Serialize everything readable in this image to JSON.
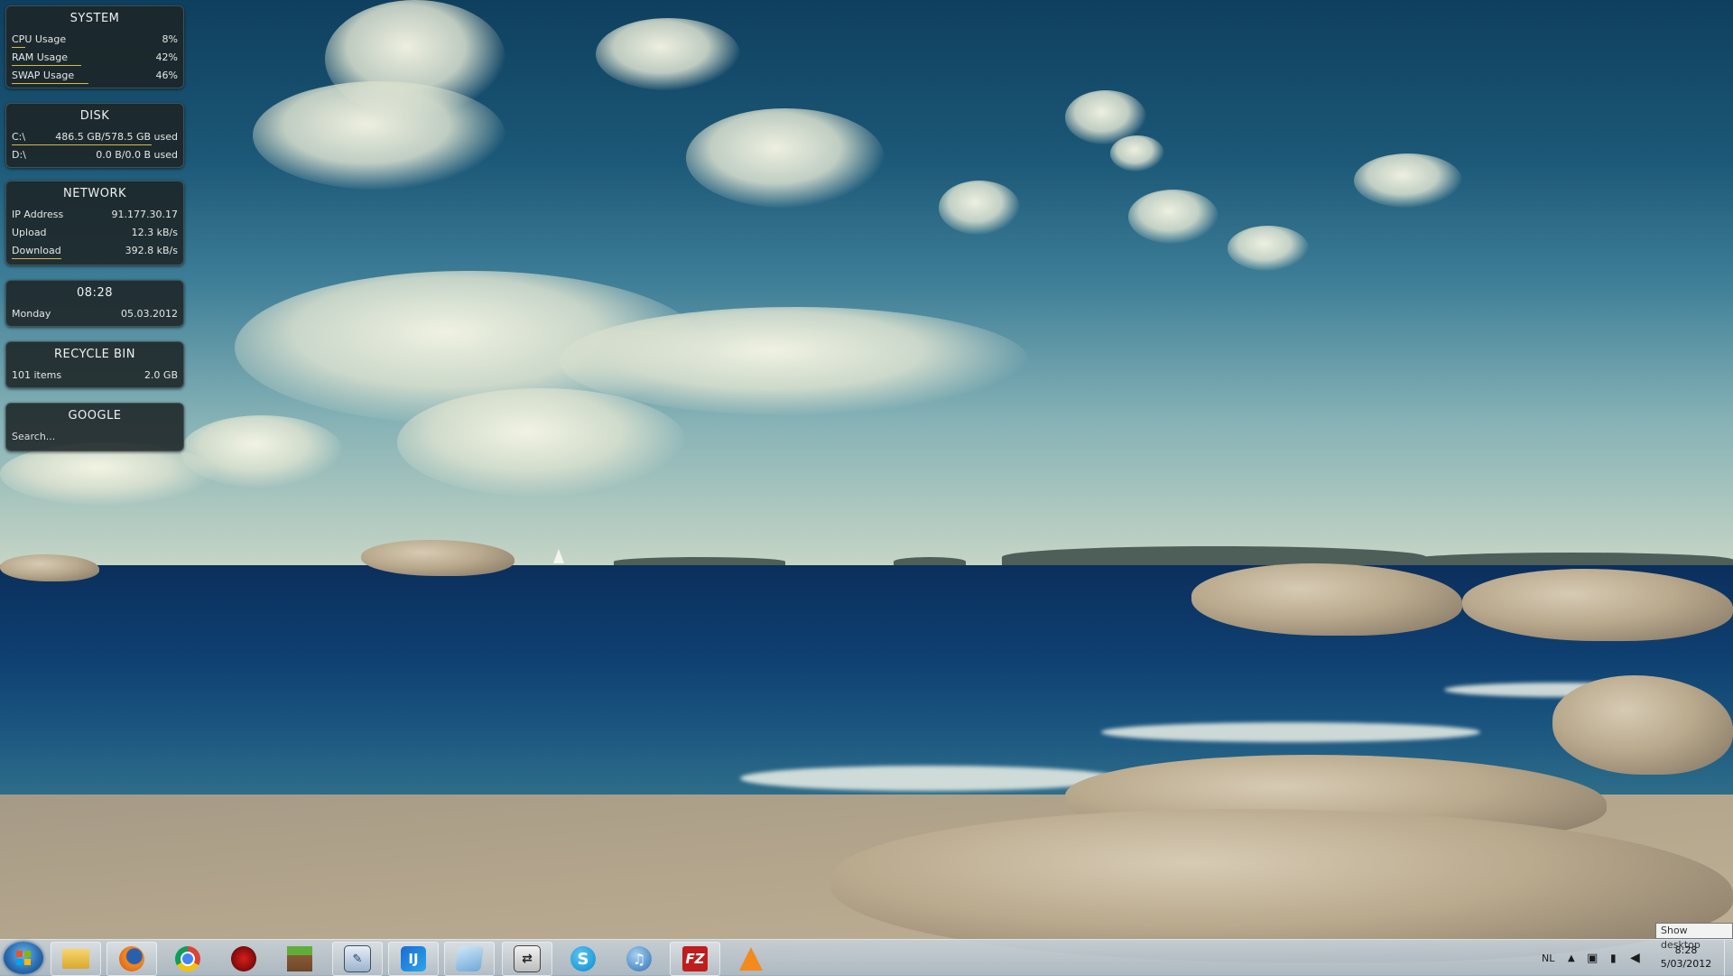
{
  "gadgets": {
    "system": {
      "title": "SYSTEM",
      "rows": [
        {
          "label": "CPU Usage",
          "value": "8%",
          "level": 0.08
        },
        {
          "label": "RAM Usage",
          "value": "42%",
          "level": 0.42
        },
        {
          "label": "SWAP Usage",
          "value": "46%",
          "level": 0.46
        }
      ]
    },
    "disk": {
      "title": "DISK",
      "rows": [
        {
          "label": "C:\\",
          "value": "486.5 GB/578.5 GB used",
          "level": 0.84
        },
        {
          "label": "D:\\",
          "value": "0.0 B/0.0 B used",
          "level": 0
        }
      ]
    },
    "network": {
      "title": "NETWORK",
      "rows": [
        {
          "label": "IP Address",
          "value": "91.177.30.17"
        },
        {
          "label": "Upload",
          "value": "12.3 kB/s"
        },
        {
          "label": "Download",
          "value": "392.8 kB/s",
          "level": 0.3
        }
      ]
    },
    "clock": {
      "time": "08:28",
      "day": "Monday",
      "date": "05.03.2012"
    },
    "recycle_bin": {
      "title": "RECYCLE BIN",
      "items": "101 items",
      "size": "2.0 GB"
    },
    "google": {
      "title": "GOOGLE",
      "placeholder": "Search..."
    }
  },
  "taskbar": {
    "pinned": [
      {
        "name": "windows-explorer",
        "icon": "folder-icon"
      },
      {
        "name": "firefox",
        "icon": "firefox-icon"
      },
      {
        "name": "chrome",
        "icon": "chrome-icon"
      },
      {
        "name": "app-red",
        "icon": "red-bird-icon"
      },
      {
        "name": "minecraft",
        "icon": "minecraft-grass-block-icon"
      },
      {
        "name": "monitor-app",
        "icon": "pen-monitor-icon"
      },
      {
        "name": "intellij",
        "icon": "intellij-icon"
      },
      {
        "name": "notes",
        "icon": "blue-notepad-icon"
      },
      {
        "name": "switcher",
        "icon": "monitor-switch-icon"
      },
      {
        "name": "skype",
        "icon": "skype-icon"
      },
      {
        "name": "itunes",
        "icon": "itunes-icon"
      },
      {
        "name": "filezilla",
        "icon": "filezilla-icon"
      },
      {
        "name": "vlc",
        "icon": "vlc-icon"
      }
    ],
    "tray": {
      "language": "NL",
      "time": "8:28",
      "date": "5/03/2012",
      "show_desktop_tooltip": "Show desktop"
    }
  },
  "colors": {
    "gadget_bar": "#d9b84a",
    "gadget_bg": "#1c2426"
  }
}
